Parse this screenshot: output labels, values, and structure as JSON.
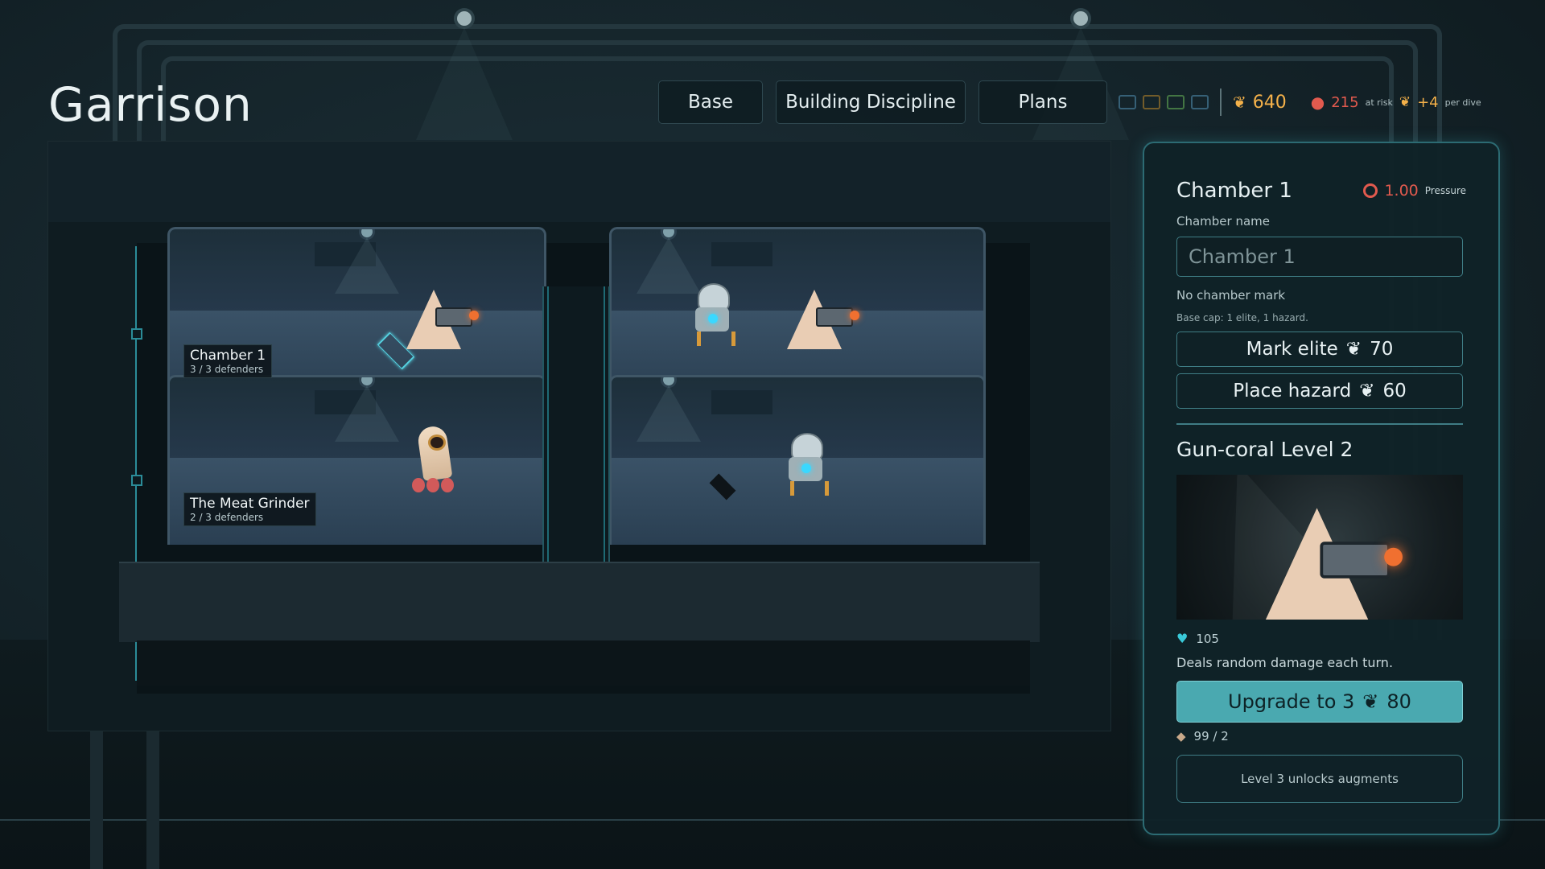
{
  "header": {
    "title": "Garrison",
    "tabs": [
      {
        "label": "Base"
      },
      {
        "label": "Building Discipline"
      },
      {
        "label": "Plans"
      }
    ]
  },
  "resources": {
    "mini_icons": [
      {
        "icon": "panel-icon",
        "color": "#3f6f8a"
      },
      {
        "icon": "crate-icon",
        "color": "#8a6a2a"
      },
      {
        "icon": "warning-box-icon",
        "color": "#4f8a4a"
      },
      {
        "icon": "card-icon",
        "color": "#3f6f8a"
      }
    ],
    "scrap": {
      "value": "640",
      "icon": "scrap-icon",
      "color": "#f4b14a"
    },
    "at_risk": {
      "value": "215",
      "label": "at risk",
      "icon": "piggy-bank-icon",
      "color": "#e25a4e"
    },
    "per_dive": {
      "value": "+4",
      "label": "per dive",
      "icon": "scrap-icon"
    }
  },
  "rooms": [
    {
      "name": "Chamber 1",
      "defenders": "3 / 3 defenders"
    },
    {
      "name": "The Meat Grinder",
      "defenders": "2 / 3 defenders"
    }
  ],
  "panel": {
    "title": "Chamber 1",
    "pressure_value": "1.00",
    "pressure_label": "Pressure",
    "chamber_name_label": "Chamber name",
    "chamber_name_placeholder": "Chamber 1",
    "no_mark": "No chamber mark",
    "base_cap": "Base cap: 1 elite, 1 hazard.",
    "mark_elite": {
      "label": "Mark elite",
      "cost": "70"
    },
    "place_hazard": {
      "label": "Place hazard",
      "cost": "60"
    },
    "unit_title": "Gun-coral Level 2",
    "health": "105",
    "description": "Deals random damage each turn.",
    "upgrade": {
      "label": "Upgrade to 3",
      "cost": "80"
    },
    "material": "99 / 2",
    "unlock_note": "Level 3 unlocks augments"
  },
  "colors": {
    "accent": "#4aa9b0",
    "scrap": "#f4b14a",
    "danger": "#e25a4e"
  }
}
